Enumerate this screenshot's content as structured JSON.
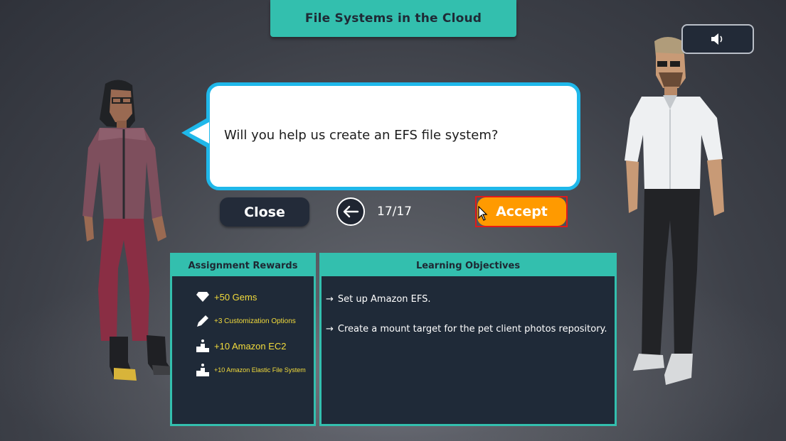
{
  "title": "File Systems in the Cloud",
  "sound_button": {
    "icon": "speaker-icon"
  },
  "dialog": {
    "text": "Will you help us create an EFS file system?"
  },
  "controls": {
    "close_label": "Close",
    "back_icon": "arrow-left-icon",
    "page_indicator": "17/17",
    "accept_label": "Accept"
  },
  "rewards": {
    "header": "Assignment Rewards",
    "items": [
      {
        "icon": "gem-icon",
        "label": "+50 Gems"
      },
      {
        "icon": "pencil-icon",
        "label": "+3 Customization Options"
      },
      {
        "icon": "rank-podium-icon",
        "label": "+10 Amazon EC2"
      },
      {
        "icon": "rank-podium-icon",
        "label": "+10 Amazon Elastic File System"
      }
    ]
  },
  "objectives": {
    "header": "Learning Objectives",
    "items": [
      "Set up Amazon EFS.",
      "Create a mount target for the pet client photos repository."
    ]
  },
  "colors": {
    "teal": "#33bfae",
    "panel_dark": "#1f2a38",
    "accept_orange": "#ff9a00",
    "bubble_border": "#1fb8ea",
    "reward_text": "#f3dc3c"
  }
}
